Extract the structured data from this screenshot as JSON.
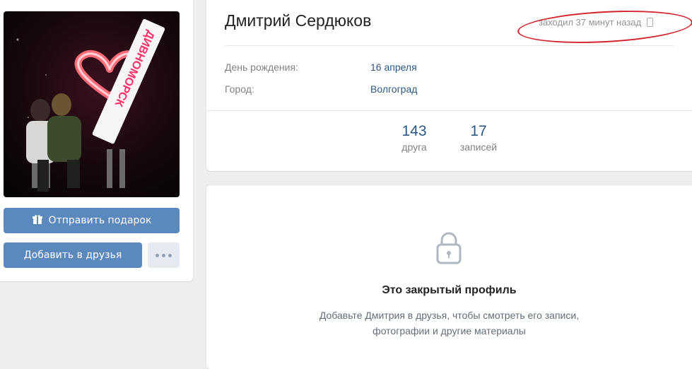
{
  "profile": {
    "name": "Дмитрий Сердюков",
    "last_seen": "заходил 37 минут назад",
    "fields": [
      {
        "label": "День рождения:",
        "value": "16 апреля"
      },
      {
        "label": "Город:",
        "value": "Волгоград"
      }
    ],
    "counters": [
      {
        "value": "143",
        "caption": "друга"
      },
      {
        "value": "17",
        "caption": "записей"
      }
    ]
  },
  "actions": {
    "gift_label": "Отправить подарок",
    "add_friend_label": "Добавить в друзья"
  },
  "closed": {
    "title": "Это закрытый профиль",
    "line1": "Добавьте Дмитрия в друзья, чтобы смотреть его записи,",
    "line2": "фотографии и другие материалы"
  },
  "photo": {
    "sign_text": "ДИВНОМОРСК"
  },
  "colors": {
    "button": "#5b88bd",
    "link": "#2a5885",
    "highlight": "#d4232b"
  }
}
